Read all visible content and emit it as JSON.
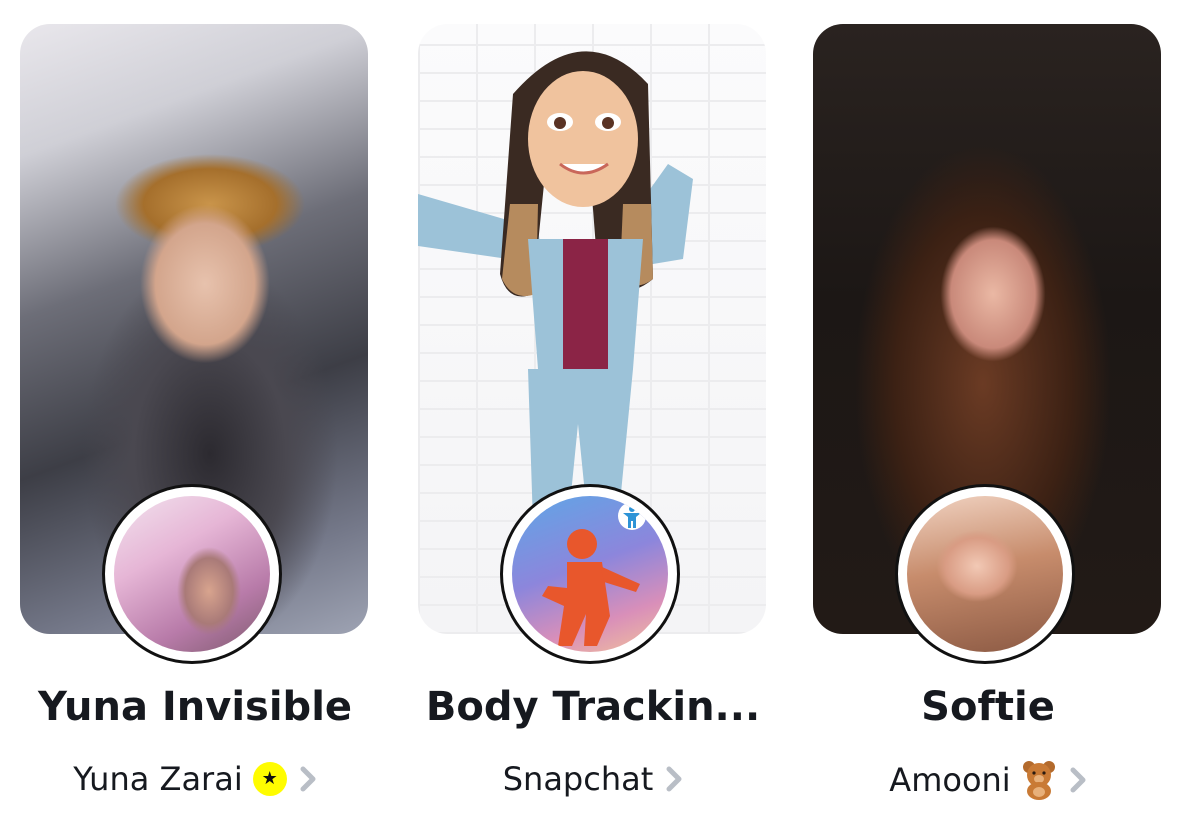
{
  "lenses": [
    {
      "title": "Yuna Invisible",
      "creator": "Yuna Zarai",
      "creator_badge": "star-icon",
      "chevron": "chevron-right-icon"
    },
    {
      "title": "Body Trackin...",
      "creator": "Snapchat",
      "chevron": "chevron-right-icon"
    },
    {
      "title": "Softie",
      "creator": "Amooni",
      "creator_emoji": "teddy-bear-icon",
      "chevron": "chevron-right-icon"
    }
  ],
  "colors": {
    "title_text": "#16191f",
    "badge_yellow": "#fffc00",
    "chevron_gray": "#b9bec6"
  }
}
